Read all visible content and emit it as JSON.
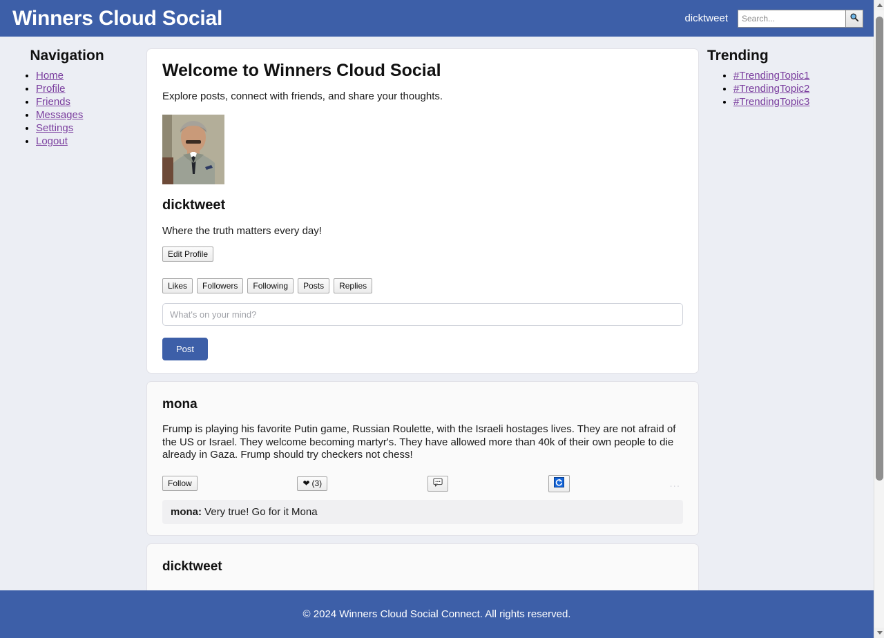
{
  "header": {
    "brand": "Winners Cloud Social",
    "user": "dicktweet",
    "search_placeholder": "Search...",
    "search_value": "",
    "search_icon": "search-icon",
    "bg_color": "#3d5fa8"
  },
  "sidebar": {
    "title": "Navigation",
    "items": [
      {
        "label": "Home"
      },
      {
        "label": "Profile"
      },
      {
        "label": "Friends"
      },
      {
        "label": "Messages"
      },
      {
        "label": "Settings"
      },
      {
        "label": "Logout"
      }
    ],
    "link_color": "#7a3d9e"
  },
  "trending": {
    "title": "Trending",
    "items": [
      {
        "label": "#TrendingTopic1"
      },
      {
        "label": "#TrendingTopic2"
      },
      {
        "label": "#TrendingTopic3"
      }
    ]
  },
  "main": {
    "welcome_title": "Welcome to Winners Cloud Social",
    "welcome_subtitle": "Explore posts, connect with friends, and share your thoughts.",
    "profile": {
      "avatar_alt": "profile-photo",
      "username": "dicktweet",
      "bio": "Where the truth matters every day!",
      "edit_button": "Edit Profile"
    },
    "tabs": [
      {
        "label": "Likes"
      },
      {
        "label": "Followers"
      },
      {
        "label": "Following"
      },
      {
        "label": "Posts"
      },
      {
        "label": "Replies"
      }
    ],
    "composer": {
      "placeholder": "What's on your mind?",
      "value": "",
      "post_button": "Post",
      "post_button_color": "#3d5fa8"
    },
    "posts": [
      {
        "author": "mona",
        "text": "Frump is playing his favorite Putin game, Russian Roulette, with the Israeli hostages lives. They are not afraid of the US or Israel. They welcome becoming martyr's. They have allowed more than 40k of their own people to die already in Gaza. Frump should try checkers not chess!",
        "follow_button": "Follow",
        "like_icon": "heart-icon",
        "like_count": "(3)",
        "comment_icon": "comment-bubble-icon",
        "repost_icon": "repost-icon",
        "more_label": "...",
        "comments": [
          {
            "user": "mona:",
            "text": "Very true! Go for it Mona"
          }
        ]
      },
      {
        "author": "dicktweet"
      }
    ]
  },
  "footer": {
    "text": "© 2024 Winners Cloud Social Connect. All rights reserved."
  }
}
